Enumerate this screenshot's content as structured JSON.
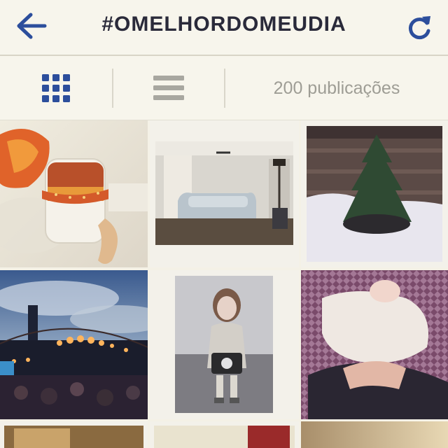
{
  "header": {
    "title": "#OMELHORDOMEUDIA",
    "back_icon": "arrow-left-icon",
    "refresh_icon": "refresh-icon",
    "accent_color": "#2c4e9c"
  },
  "tabs": {
    "grid_icon": "grid-view-icon",
    "list_icon": "list-view-icon",
    "posts_count": "200 publicações"
  },
  "photos": [
    {
      "subject": "dessert jar with ribbon and spoon"
    },
    {
      "subject": "living room with sofa"
    },
    {
      "subject": "pine tree in snow"
    },
    {
      "subject": "evening outdoor party with string lights"
    },
    {
      "subject": "girl holding a phone"
    },
    {
      "subject": "baby in knitted blanket"
    },
    {
      "subject": "dim interior"
    },
    {
      "subject": "doorway"
    },
    {
      "subject": "sunset sky"
    }
  ]
}
